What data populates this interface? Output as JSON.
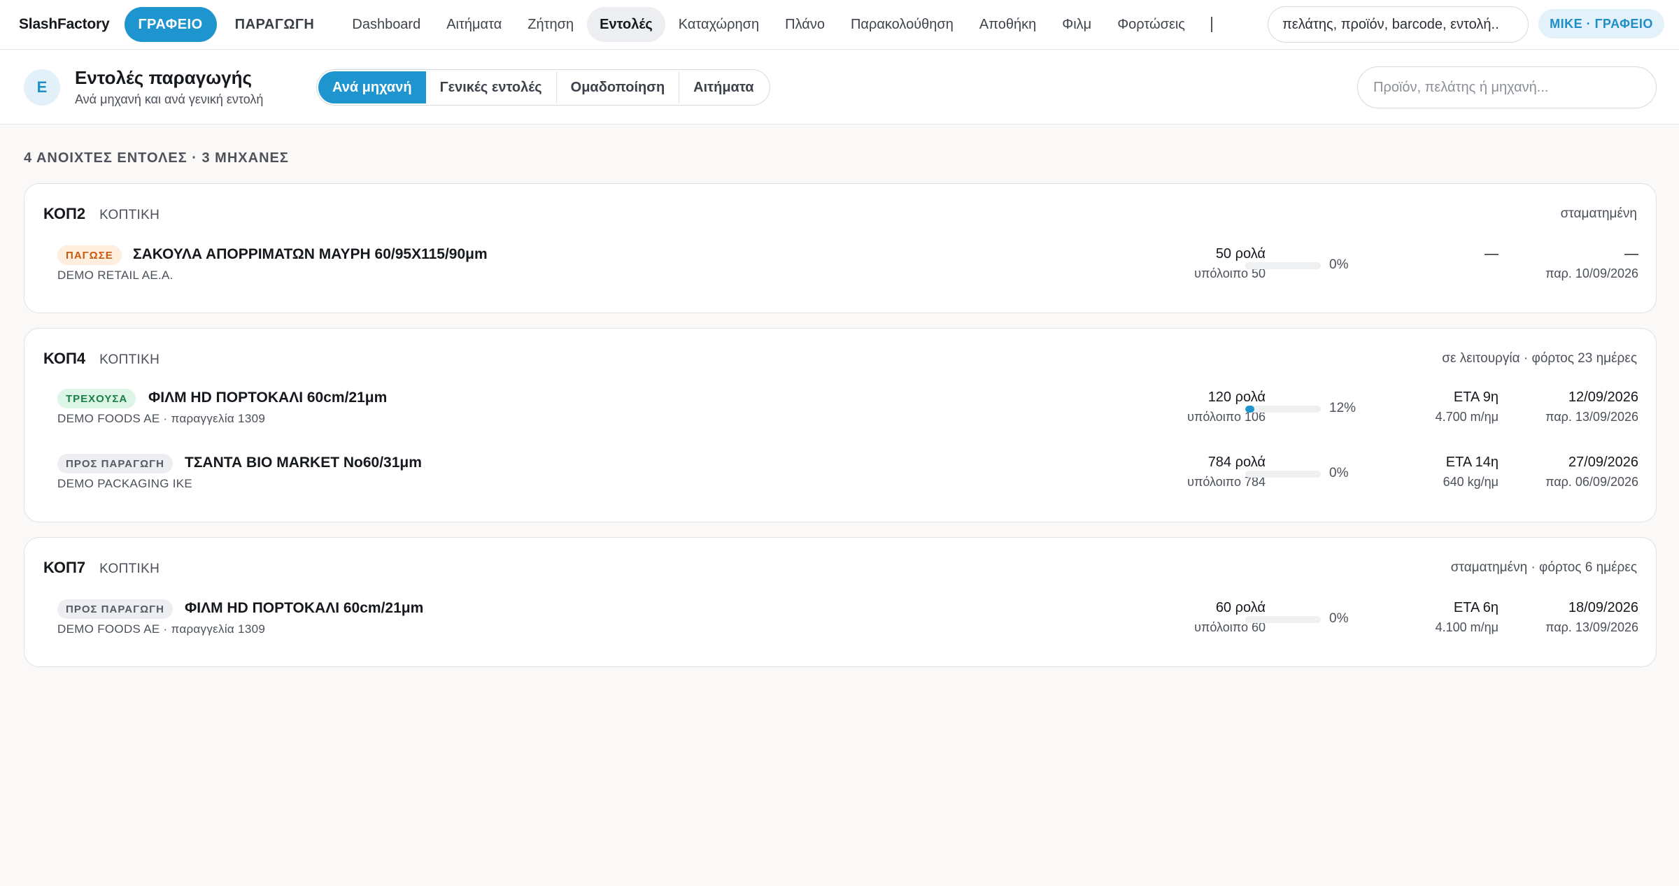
{
  "topbar": {
    "brand": "SlashFactory",
    "mode_active": "ΓΡΑΦΕΙΟ",
    "mode_other": "ΠΑΡΑΓΩΓΗ",
    "nav": [
      {
        "label": "Dashboard",
        "active": false
      },
      {
        "label": "Αιτήματα",
        "active": false
      },
      {
        "label": "Ζήτηση",
        "active": false
      },
      {
        "label": "Εντολές",
        "active": true
      },
      {
        "label": "Καταχώρηση",
        "active": false
      },
      {
        "label": "Πλάνο",
        "active": false
      },
      {
        "label": "Παρακολούθηση",
        "active": false
      },
      {
        "label": "Αποθήκη",
        "active": false
      },
      {
        "label": "Φιλμ",
        "active": false
      },
      {
        "label": "Φορτώσεις",
        "active": false
      }
    ],
    "search_value": "πελάτης, προϊόν, barcode, εντολή..",
    "user": "ΜΙΚΕ · ΓΡΑΦΕΙΟ"
  },
  "subheader": {
    "avatar_letter": "Ε",
    "title": "Εντολές παραγωγής",
    "subtitle": "Ανά μηχανή και ανά γενική εντολή",
    "tabs": [
      {
        "label": "Ανά μηχανή",
        "active": true
      },
      {
        "label": "Γενικές εντολές",
        "active": false
      },
      {
        "label": "Ομαδοποίηση",
        "active": false
      },
      {
        "label": "Αιτήματα",
        "active": false
      }
    ],
    "search_placeholder": "Προϊόν, πελάτης ή μηχανή..."
  },
  "summary": "4 ΑΝΟΙΧΤΕΣ ΕΝΤΟΛΕΣ · 3 ΜΗΧΑΝΕΣ",
  "machines": [
    {
      "code": "ΚΟΠ2",
      "type": "ΚΟΠΤΙΚΗ",
      "status": "σταματημένη",
      "orders": [
        {
          "badge": "ΠΑΓΩΣΕ",
          "badge_kind": "paused",
          "title": "ΣΑΚΟΥΛΑ ΑΠΟΡΡΙΜΑΤΩΝ ΜΑΥΡΗ 60/95Χ115/90μm",
          "client": "DEMO RETAIL AE.A.",
          "qty": "50 ρολά",
          "remaining": "υπόλοιπο 50",
          "progress": 0,
          "progress_label": "0%",
          "eta": "—",
          "eta_sub": "",
          "date": "—",
          "date_sub": "παρ. 10/09/2026"
        }
      ]
    },
    {
      "code": "ΚΟΠ4",
      "type": "ΚΟΠΤΙΚΗ",
      "status": "σε λειτουργία · φόρτος 23 ημέρες",
      "orders": [
        {
          "badge": "ΤΡΕΧΟΥΣΑ",
          "badge_kind": "running",
          "title": "ΦΙΛΜ HD ΠΟΡΤΟΚΑΛΙ 60cm/21μm",
          "client": "DEMO FOODS AE · παραγγελία 1309",
          "qty": "120 ρολά",
          "remaining": "υπόλοιπο 106",
          "progress": 12,
          "progress_label": "12%",
          "eta": "ETA 9η",
          "eta_sub": "4.700 m/ημ",
          "date": "12/09/2026",
          "date_sub": "παρ. 13/09/2026"
        },
        {
          "badge": "ΠΡΟΣ ΠΑΡΑΓΩΓΗ",
          "badge_kind": "queued",
          "title": "ΤΣΑΝΤΑ BIO MARKET No60/31μm",
          "client": "DEMO PACKAGING IKE",
          "qty": "784 ρολά",
          "remaining": "υπόλοιπο 784",
          "progress": 0,
          "progress_label": "0%",
          "eta": "ETA 14η",
          "eta_sub": "640 kg/ημ",
          "date": "27/09/2026",
          "date_sub": "παρ. 06/09/2026"
        }
      ]
    },
    {
      "code": "ΚΟΠ7",
      "type": "ΚΟΠΤΙΚΗ",
      "status": "σταματημένη · φόρτος 6 ημέρες",
      "orders": [
        {
          "badge": "ΠΡΟΣ ΠΑΡΑΓΩΓΗ",
          "badge_kind": "queued",
          "title": "ΦΙΛΜ HD ΠΟΡΤΟΚΑΛΙ 60cm/21μm",
          "client": "DEMO FOODS AE · παραγγελία 1309",
          "qty": "60 ρολά",
          "remaining": "υπόλοιπο 60",
          "progress": 0,
          "progress_label": "0%",
          "eta": "ETA 6η",
          "eta_sub": "4.100 m/ημ",
          "date": "18/09/2026",
          "date_sub": "παρ. 13/09/2026"
        }
      ]
    }
  ],
  "colors": {
    "accent": "#1e95cf",
    "paused_badge": "#fdeedd",
    "running_badge": "#dcf5e6",
    "queued_badge": "#eceef1"
  }
}
